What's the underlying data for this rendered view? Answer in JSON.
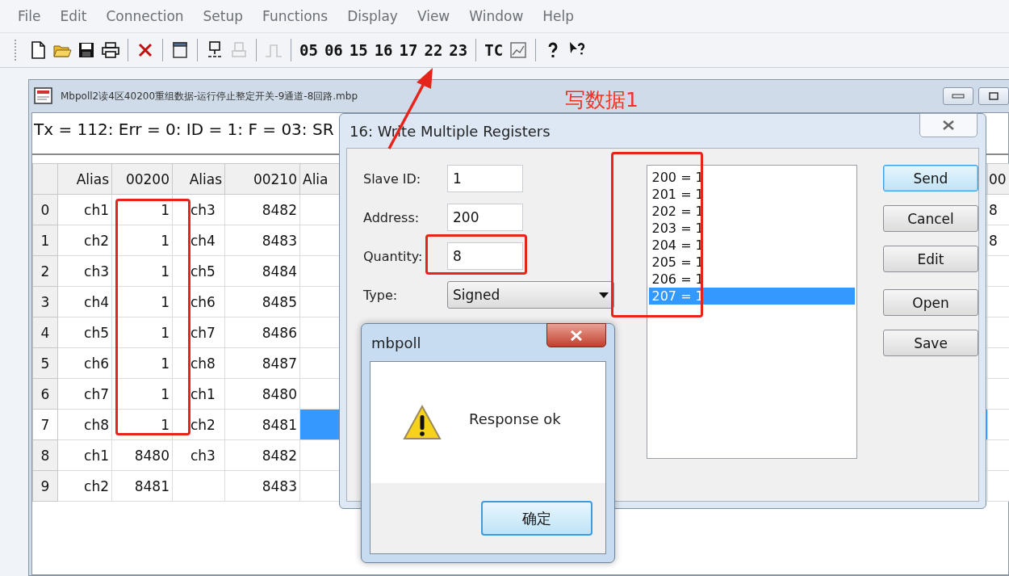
{
  "menu": [
    "File",
    "Edit",
    "Connection",
    "Setup",
    "Functions",
    "Display",
    "View",
    "Window",
    "Help"
  ],
  "toolbar": [
    {
      "kind": "icon",
      "disabled": false
    },
    {
      "kind": "icon",
      "disabled": false
    },
    {
      "kind": "icon",
      "disabled": false
    },
    {
      "kind": "icon",
      "disabled": false
    },
    {
      "kind": "separator"
    },
    {
      "kind": "icon",
      "disabled": false
    },
    {
      "kind": "separator"
    },
    {
      "kind": "icon",
      "disabled": false
    },
    {
      "kind": "separator"
    },
    {
      "kind": "icon",
      "disabled": false
    },
    {
      "kind": "icon",
      "disabled": true
    },
    {
      "kind": "separator"
    },
    {
      "kind": "icon",
      "disabled": true
    },
    {
      "kind": "separator"
    },
    {
      "kind": "text",
      "label": "05"
    },
    {
      "kind": "text",
      "label": "06"
    },
    {
      "kind": "text",
      "label": "15"
    },
    {
      "kind": "text",
      "label": "16"
    },
    {
      "kind": "text",
      "label": "17"
    },
    {
      "kind": "text",
      "label": "22"
    },
    {
      "kind": "text",
      "label": "23"
    },
    {
      "kind": "separator"
    },
    {
      "kind": "text",
      "label": "TC"
    },
    {
      "kind": "icon",
      "disabled": false
    },
    {
      "kind": "separator"
    },
    {
      "kind": "icon",
      "disabled": false
    },
    {
      "kind": "icon",
      "disabled": false
    }
  ],
  "document": {
    "title": "Mbpoll2读4区40200重组数据-运行停止整定开关-9通道-8回路.mbp",
    "status": "Tx = 112: Err = 0: ID = 1: F = 03: SR",
    "table": {
      "columns": [
        "Alias",
        "00200",
        "Alias",
        "00210",
        "Alia"
      ],
      "column_7": "00",
      "rows": [
        {
          "row": "0",
          "alias_1": "ch1",
          "value_1": "1",
          "alias_2": "ch3",
          "value_2": "8482",
          "column_7": "8",
          "selected": false
        },
        {
          "row": "1",
          "alias_1": "ch2",
          "value_1": "1",
          "alias_2": "ch4",
          "value_2": "8483",
          "column_7": "8",
          "selected": false
        },
        {
          "row": "2",
          "alias_1": "ch3",
          "value_1": "1",
          "alias_2": "ch5",
          "value_2": "8484",
          "selected": false
        },
        {
          "row": "3",
          "alias_1": "ch4",
          "value_1": "1",
          "alias_2": "ch6",
          "value_2": "8485",
          "selected": false
        },
        {
          "row": "4",
          "alias_1": "ch5",
          "value_1": "1",
          "alias_2": "ch7",
          "value_2": "8486",
          "selected": false
        },
        {
          "row": "5",
          "alias_1": "ch6",
          "value_1": "1",
          "alias_2": "ch8",
          "value_2": "8487",
          "selected": false
        },
        {
          "row": "6",
          "alias_1": "ch7",
          "value_1": "1",
          "alias_2": "ch1",
          "value_2": "8480",
          "selected": false
        },
        {
          "row": "7",
          "alias_1": "ch8",
          "value_1": "1",
          "alias_2": "ch2",
          "value_2": "8481",
          "selected": true
        },
        {
          "row": "8",
          "alias_1": "ch1",
          "value_1": "8480",
          "alias_2": "ch3",
          "value_2": "8482",
          "selected": false
        },
        {
          "row": "9",
          "alias_1": "ch2",
          "value_1": "8481",
          "value_2": "8483",
          "selected": false
        }
      ]
    }
  },
  "write_dialog": {
    "title": "16: Write Multiple Registers",
    "fields": [
      {
        "label": "Slave ID:",
        "value": "1"
      },
      {
        "label": "Address:",
        "value": "200"
      },
      {
        "label": "Quantity:",
        "value": "8"
      }
    ],
    "type": {
      "label": "Type:",
      "value": "Signed"
    },
    "values": [
      {
        "text": "200 = 1",
        "selected": false
      },
      {
        "text": "201 = 1",
        "selected": false
      },
      {
        "text": "202 = 1",
        "selected": false
      },
      {
        "text": "203 = 1",
        "selected": false
      },
      {
        "text": "204 = 1",
        "selected": false
      },
      {
        "text": "205 = 1",
        "selected": false
      },
      {
        "text": "206 = 1",
        "selected": false
      },
      {
        "text": "207 = 1",
        "selected": true
      }
    ],
    "buttons": [
      {
        "label": "Send",
        "default": true
      },
      {
        "label": "Cancel",
        "default": false
      },
      {
        "label": "Edit",
        "default": false
      },
      {
        "label": "Open",
        "default": false
      },
      {
        "label": "Save",
        "default": false
      }
    ]
  },
  "message_box": {
    "title": "mbpoll",
    "message": "Response ok",
    "button": "确定"
  },
  "annotation": {
    "text": "写数据1"
  }
}
